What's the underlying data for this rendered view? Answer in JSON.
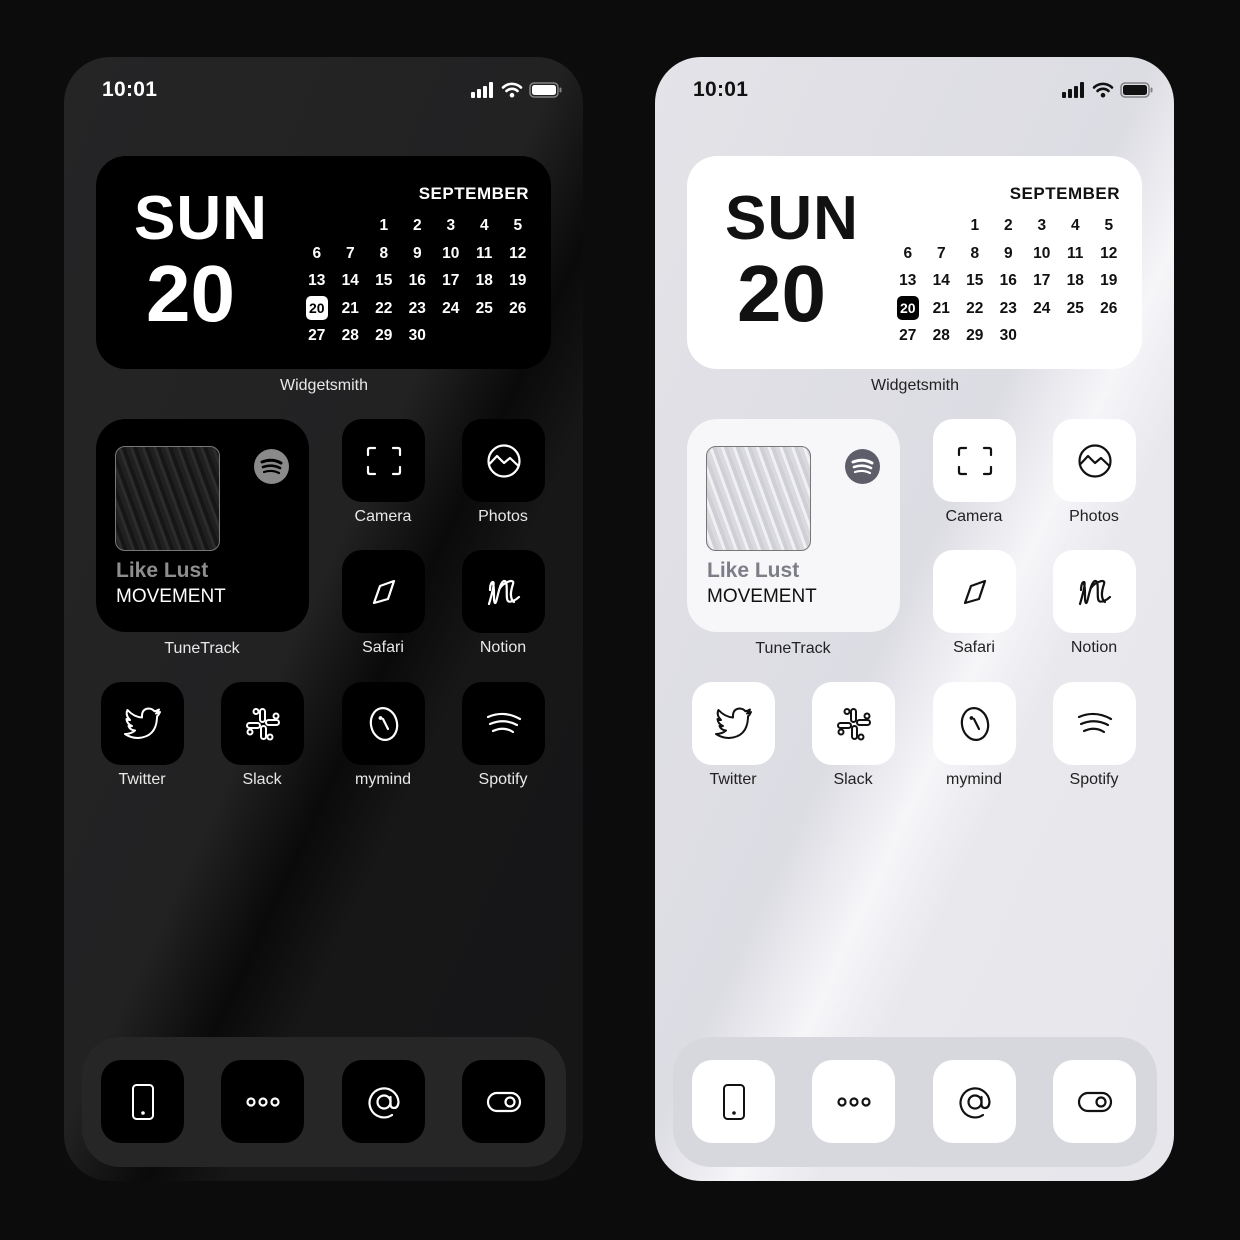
{
  "status_bar": {
    "time": "10:01"
  },
  "calendar_widget": {
    "day_name": "SUN",
    "day_number": "20",
    "month": "SEPTEMBER",
    "leading_blanks": 2,
    "days": [
      "1",
      "2",
      "3",
      "4",
      "5",
      "6",
      "7",
      "8",
      "9",
      "10",
      "11",
      "12",
      "13",
      "14",
      "15",
      "16",
      "17",
      "18",
      "19",
      "20",
      "21",
      "22",
      "23",
      "24",
      "25",
      "26",
      "27",
      "28",
      "29",
      "30"
    ],
    "today": "20",
    "label": "Widgetsmith"
  },
  "music_widget": {
    "song_title": "Like Lust",
    "artist": "MOVEMENT",
    "service_icon": "spotify-icon",
    "label": "TuneTrack"
  },
  "apps": {
    "camera": {
      "label": "Camera",
      "icon": "camera-viewfinder-icon"
    },
    "photos": {
      "label": "Photos",
      "icon": "photos-mountain-icon"
    },
    "safari": {
      "label": "Safari",
      "icon": "compass-icon"
    },
    "notion": {
      "label": "Notion",
      "icon": "notion-n-icon"
    },
    "twitter": {
      "label": "Twitter",
      "icon": "twitter-bird-icon"
    },
    "slack": {
      "label": "Slack",
      "icon": "slack-icon"
    },
    "mymind": {
      "label": "mymind",
      "icon": "mymind-icon"
    },
    "spotify": {
      "label": "Spotify",
      "icon": "spotify-waves-icon"
    }
  },
  "dock": [
    {
      "name": "phone",
      "icon": "phone-device-icon"
    },
    {
      "name": "messages",
      "icon": "ellipsis-icon"
    },
    {
      "name": "mail",
      "icon": "at-sign-icon"
    },
    {
      "name": "settings",
      "icon": "toggle-icon"
    }
  ],
  "themes": [
    {
      "name": "dark",
      "background": "#222223",
      "tile": "#000000",
      "glyph": "#ffffff"
    },
    {
      "name": "light",
      "background": "#e0e0e6",
      "tile": "#ffffff",
      "glyph": "#111111"
    }
  ]
}
